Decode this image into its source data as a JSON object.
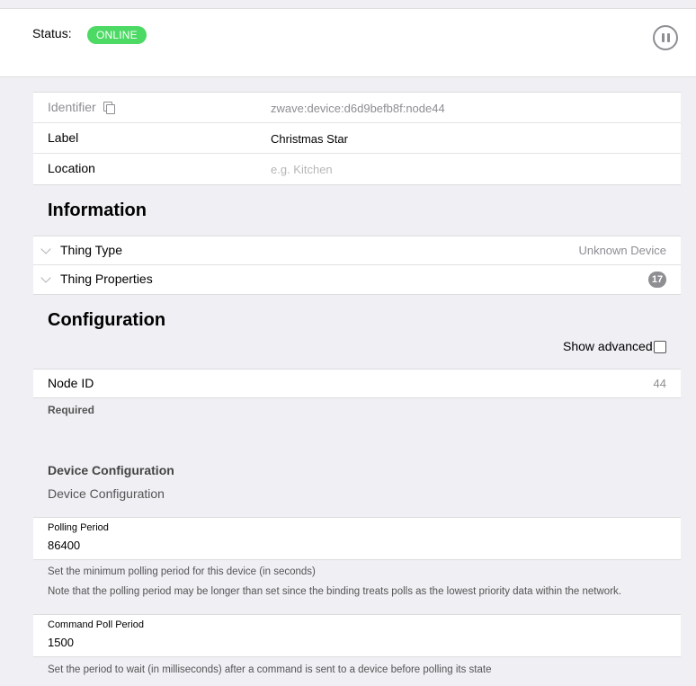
{
  "status": {
    "label": "Status:",
    "badge": "ONLINE",
    "badge_color": "#4cd964",
    "pause_icon": "pause-circle-icon"
  },
  "details": {
    "identifier_label": "Identifier",
    "identifier_value": "zwave:device:d6d9befb8f:node44",
    "copy_icon": "copy-icon",
    "label_label": "Label",
    "label_value": "Christmas Star",
    "location_label": "Location",
    "location_placeholder": "e.g. Kitchen"
  },
  "information": {
    "title": "Information",
    "thing_type_label": "Thing Type",
    "thing_type_value": "Unknown Device",
    "thing_properties_label": "Thing Properties",
    "thing_properties_count": "17"
  },
  "configuration": {
    "title": "Configuration",
    "show_advanced_label": "Show advanced",
    "node_id_label": "Node ID",
    "node_id_value": "44",
    "required_label": "Required",
    "group_title": "Device Configuration",
    "group_subtitle": "Device Configuration",
    "polling_period_label": "Polling Period",
    "polling_period_value": "86400",
    "polling_hint_1": "Set the minimum polling period for this device (in seconds)",
    "polling_hint_2": "Note that the polling period may be longer than set since the binding treats polls as the lowest priority data within the network.",
    "command_poll_label": "Command Poll Period",
    "command_poll_value": "1500",
    "command_poll_hint": "Set the period to wait (in milliseconds) after a command is sent to a device before polling its state"
  }
}
